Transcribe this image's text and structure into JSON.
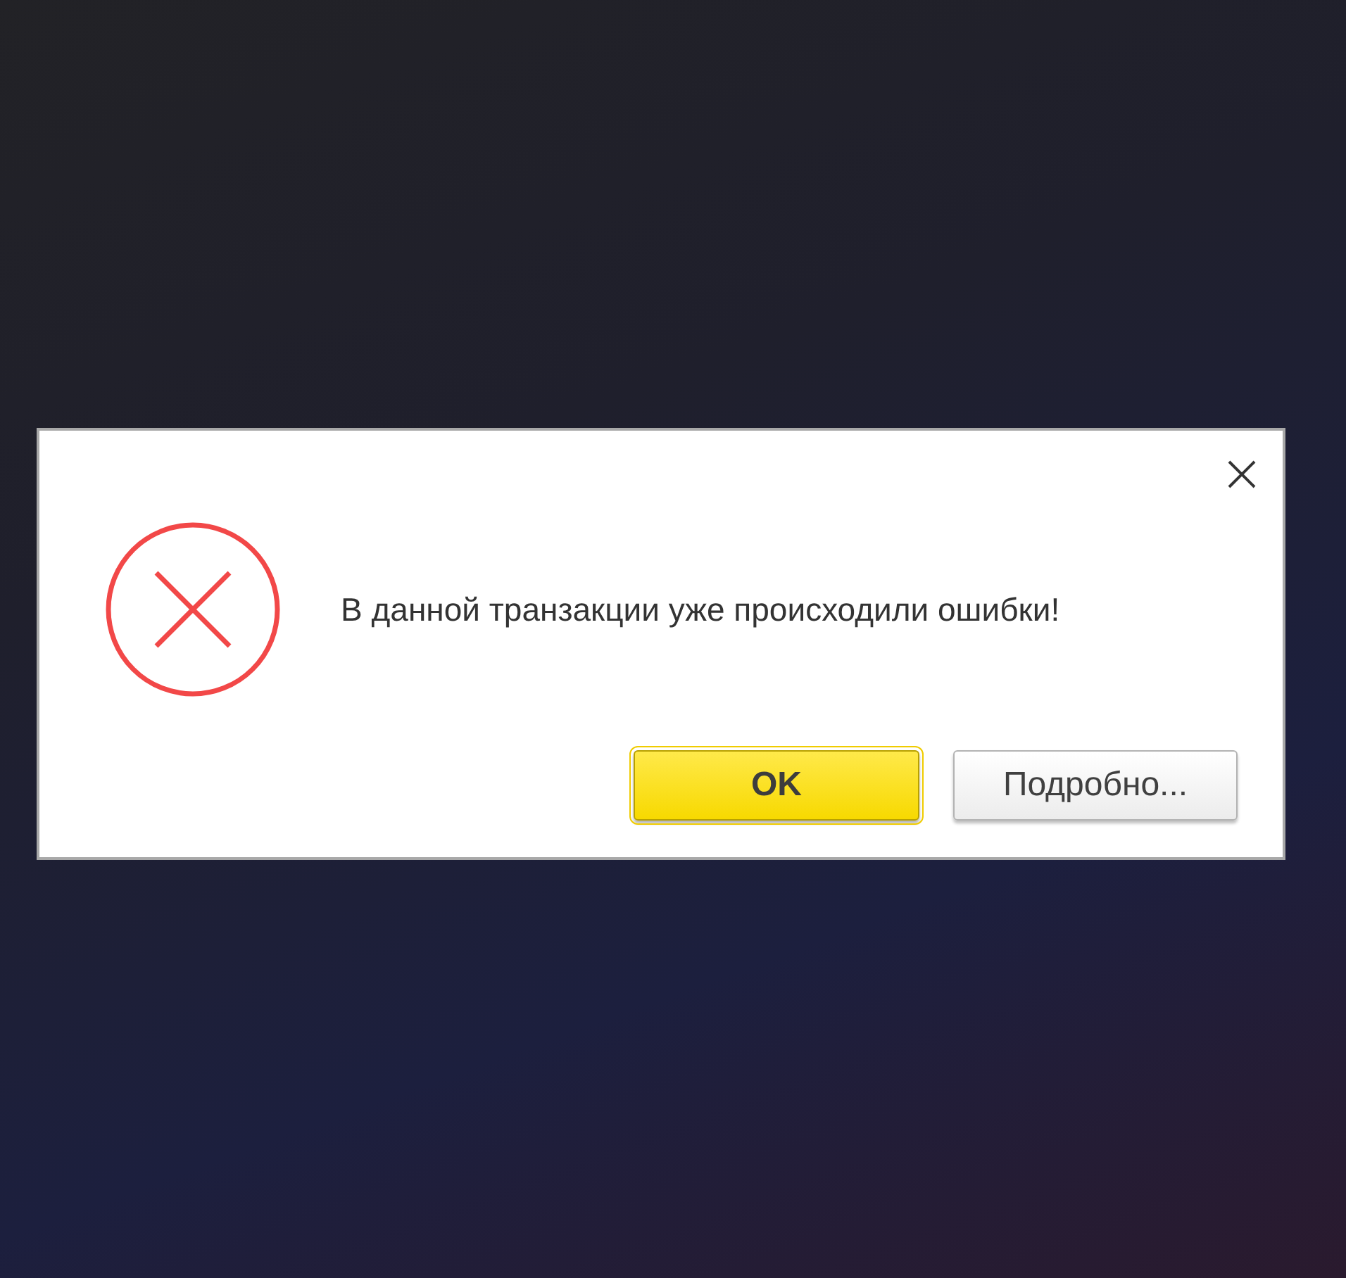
{
  "dialog": {
    "message": "В данной транзакции уже происходили ошибки!",
    "buttons": [
      {
        "label": "OK",
        "kind": "primary",
        "focused": true
      },
      {
        "label": "Подробно...",
        "kind": "secondary",
        "focused": false
      }
    ]
  }
}
